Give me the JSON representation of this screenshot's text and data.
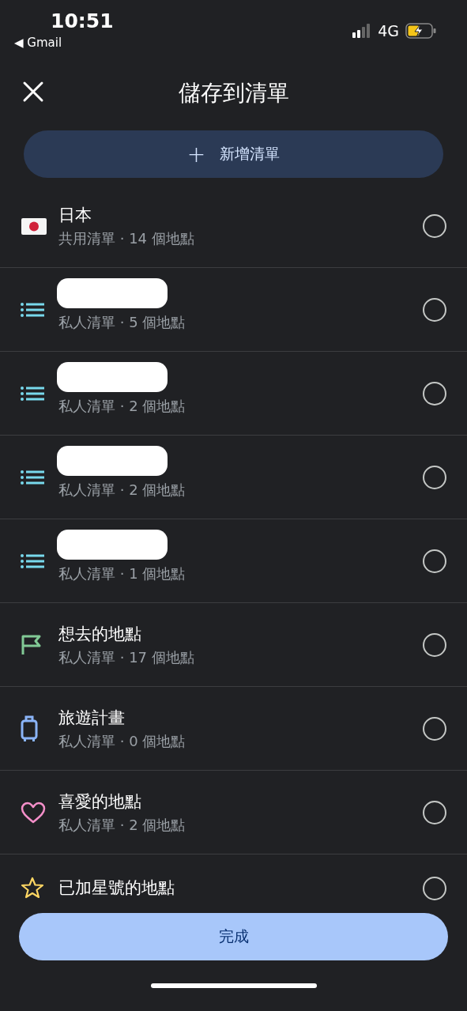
{
  "status_bar": {
    "time": "10:51",
    "back_app": "◀ Gmail",
    "network": "4G",
    "charging": true
  },
  "header": {
    "title": "儲存到清單"
  },
  "new_list_button": {
    "icon": "+",
    "label": "新增清單"
  },
  "lists": [
    {
      "kind": "japan-flag",
      "title": "日本",
      "subtitle": "共用清單 · 14 個地點",
      "redacted": false,
      "selected": false
    },
    {
      "kind": "list",
      "subtitle": "私人清單 · 5 個地點",
      "redacted": true,
      "selected": false
    },
    {
      "kind": "list",
      "subtitle": "私人清單 · 2 個地點",
      "redacted": true,
      "selected": false
    },
    {
      "kind": "list",
      "subtitle": "私人清單 · 2 個地點",
      "redacted": true,
      "selected": false
    },
    {
      "kind": "list",
      "subtitle": "私人清單 · 1 個地點",
      "redacted": true,
      "selected": false
    },
    {
      "kind": "flag",
      "title": "想去的地點",
      "subtitle": "私人清單 · 17 個地點",
      "redacted": false,
      "selected": false
    },
    {
      "kind": "luggage",
      "title": "旅遊計畫",
      "subtitle": "私人清單 · 0 個地點",
      "redacted": false,
      "selected": false
    },
    {
      "kind": "heart",
      "title": "喜愛的地點",
      "subtitle": "私人清單 · 2 個地點",
      "redacted": false,
      "selected": false
    },
    {
      "kind": "star",
      "title": "已加星號的地點",
      "redacted": false,
      "selected": false
    }
  ],
  "done_button": {
    "label": "完成"
  }
}
